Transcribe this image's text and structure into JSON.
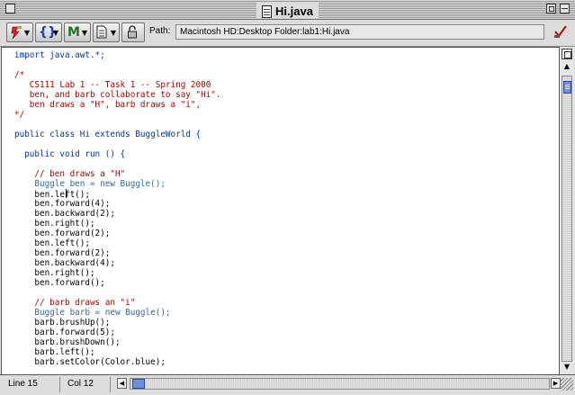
{
  "window": {
    "title": "Hi.java"
  },
  "toolbar": {
    "buttons": [
      {
        "name": "build-menu",
        "icon": "lightning-hammer-icon"
      },
      {
        "name": "functions-menu",
        "icon": "braces-icon",
        "glyph": "{}"
      },
      {
        "name": "markers-menu",
        "icon": "marker-m-icon",
        "glyph": "M"
      },
      {
        "name": "document-menu",
        "icon": "document-icon"
      },
      {
        "name": "lock-menu",
        "icon": "lock-icon"
      }
    ],
    "path_label": "Path:",
    "path_value": "Macintosh HD:Desktop Folder:lab1:Hi.java",
    "check_icon": "checkmark-icon"
  },
  "editor": {
    "lines": [
      "import java.awt.*;",
      "",
      "/*",
      "   CS111 Lab 1 -- Task 1 -- Spring 2000",
      "   ben, and barb collaborate to say \"Hi\".",
      "   ben draws a \"H\", barb draws a \"i\",",
      "*/",
      "",
      "public class Hi extends BuggleWorld {",
      "",
      "  public void run () {",
      "",
      "    // ben draws a \"H\"",
      "    Buggle ben = new Buggle();",
      "    ben.left();",
      "    ben.forward(4);",
      "    ben.backward(2);",
      "    ben.right();",
      "    ben.forward(2);",
      "    ben.left();",
      "    ben.forward(2);",
      "    ben.backward(4);",
      "    ben.right();",
      "    ben.forward();",
      "",
      "    // barb draws an \"i\"",
      "    Buggle barb = new Buggle();",
      "    barb.brushUp();",
      "    barb.forward(5);",
      "    barb.brushDown();",
      "    barb.left();",
      "    barb.setColor(Color.blue);"
    ]
  },
  "status": {
    "line": "Line 15",
    "col": "Col 12"
  },
  "colors": {
    "keyword": "#003399",
    "comment": "#990000",
    "method": "#336699",
    "scroll_thumb": "#6a8fdc"
  }
}
